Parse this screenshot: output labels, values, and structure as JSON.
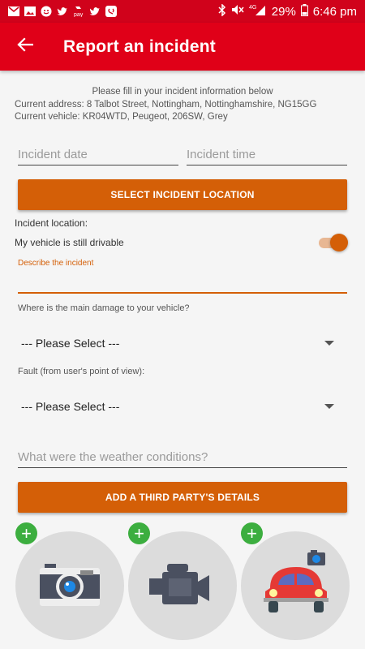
{
  "status_bar": {
    "battery": "29%",
    "time": "6:46 pm",
    "network": "4G"
  },
  "app_bar": {
    "title": "Report an incident"
  },
  "info": {
    "line1": "Please fill in your incident information below",
    "line2": "Current address: 8 Talbot Street, Nottingham, Nottinghamshire, NG15GG",
    "line3": "Current vehicle: KR04WTD, Peugeot, 206SW, Grey"
  },
  "form": {
    "incident_date_placeholder": "Incident date",
    "incident_time_placeholder": "Incident time",
    "select_location_label": "SELECT INCIDENT LOCATION",
    "incident_location_label": "Incident location:",
    "drivable_label": "My vehicle is still drivable",
    "drivable_on": true,
    "describe_label": "Describe the incident",
    "damage_question": "Where is the main damage to your vehicle?",
    "damage_value": "--- Please Select ---",
    "fault_question": "Fault (from user's point of view):",
    "fault_value": "--- Please Select ---",
    "weather_placeholder": "What were the weather conditions?",
    "third_party_label": "ADD A THIRD PARTY'S DETAILS"
  },
  "media": [
    {
      "name": "photo",
      "icon": "camera-icon"
    },
    {
      "name": "video",
      "icon": "video-camera-icon"
    },
    {
      "name": "vehicle-photo",
      "icon": "car-camera-icon"
    }
  ],
  "colors": {
    "status_bar": "#d0021b",
    "app_bar": "#e00018",
    "accent_orange": "#d45f07",
    "add_green": "#3cae3f"
  }
}
